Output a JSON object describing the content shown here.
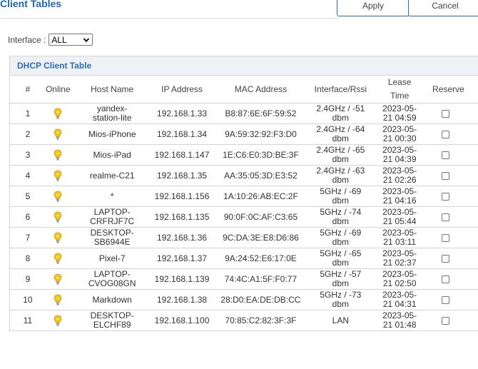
{
  "header": {
    "title": "Client Tables",
    "apply_label": "Apply",
    "cancel_label": "Cancel"
  },
  "interface_filter": {
    "label": "Interface :",
    "selected": "ALL"
  },
  "panel": {
    "title": "DHCP Client Table"
  },
  "table": {
    "columns": {
      "num": "#",
      "online": "Online",
      "host": "Host Name",
      "ip": "IP Address",
      "mac": "MAC Address",
      "iface": "Interface/Rssi",
      "lease_1": "Lease",
      "lease_2": "Time",
      "reserve": "Reserve"
    },
    "rows": [
      {
        "num": "1",
        "host": "yandex-\nstation-lite",
        "ip": "192.168.1.33",
        "mac": "B8:87:6E:6F:59:52",
        "iface": "2.4GHz / -51\ndbm",
        "lease": "2023-05-\n21 04:59",
        "online": true,
        "reserved": false
      },
      {
        "num": "2",
        "host": "Mios-iPhone",
        "ip": "192.168.1.34",
        "mac": "9A:59:32:92:F3:D0",
        "iface": "2.4GHz / -64\ndbm",
        "lease": "2023-05-\n21 00:30",
        "online": true,
        "reserved": false
      },
      {
        "num": "3",
        "host": "Mios-iPad",
        "ip": "192.168.1.147",
        "mac": "1E:C6:E0:3D:BE:3F",
        "iface": "2.4GHz / -65\ndbm",
        "lease": "2023-05-\n21 04:39",
        "online": true,
        "reserved": false
      },
      {
        "num": "4",
        "host": "realme-C21",
        "ip": "192.168.1.35",
        "mac": "AA:35:05:3D:E3:52",
        "iface": "2.4GHz / -63\ndbm",
        "lease": "2023-05-\n21 02:26",
        "online": true,
        "reserved": false
      },
      {
        "num": "5",
        "host": "*",
        "ip": "192.168.1.156",
        "mac": "1A:10:26:AB:EC:2F",
        "iface": "5GHz / -69\ndbm",
        "lease": "2023-05-\n21 04:16",
        "online": true,
        "reserved": false
      },
      {
        "num": "6",
        "host": "LAPTOP-\nCRFRJF7C",
        "ip": "192.168.1.135",
        "mac": "90:0F:0C:AF:C3:65",
        "iface": "5GHz / -74\ndbm",
        "lease": "2023-05-\n21 05:44",
        "online": true,
        "reserved": false
      },
      {
        "num": "7",
        "host": "DESKTOP-\nSB6944E",
        "ip": "192.168.1.36",
        "mac": "9C:DA:3E:E8:D6:86",
        "iface": "5GHz / -69\ndbm",
        "lease": "2023-05-\n21 03:11",
        "online": true,
        "reserved": false
      },
      {
        "num": "8",
        "host": "Pixel-7",
        "ip": "192.168.1.37",
        "mac": "9A:24:52:E6:17:0E",
        "iface": "5GHz / -65\ndbm",
        "lease": "2023-05-\n21 02:37",
        "online": true,
        "reserved": false
      },
      {
        "num": "9",
        "host": "LAPTOP-\nCVOG08GN",
        "ip": "192.168.1.139",
        "mac": "74:4C:A1:5F:F0:77",
        "iface": "5GHz / -57\ndbm",
        "lease": "2023-05-\n21 02:50",
        "online": true,
        "reserved": false
      },
      {
        "num": "10",
        "host": "Markdown",
        "ip": "192.168.1.38",
        "mac": "28:D0:EA:DE:DB:CC",
        "iface": "5GHz / -73\ndbm",
        "lease": "2023-05-\n21 04:31",
        "online": true,
        "reserved": false
      },
      {
        "num": "11",
        "host": "DESKTOP-\nELCHF89",
        "ip": "192.168.1.100",
        "mac": "70:85:C2:82:3F:3F",
        "iface": "LAN",
        "lease": "2023-05-\n21 01:48",
        "online": true,
        "reserved": false
      }
    ]
  },
  "colors": {
    "accent": "#2a6fb5",
    "bulb": "#f2c61f"
  },
  "icons": {
    "online": "lightbulb-icon",
    "dropdown": "chevron-down-icon"
  }
}
